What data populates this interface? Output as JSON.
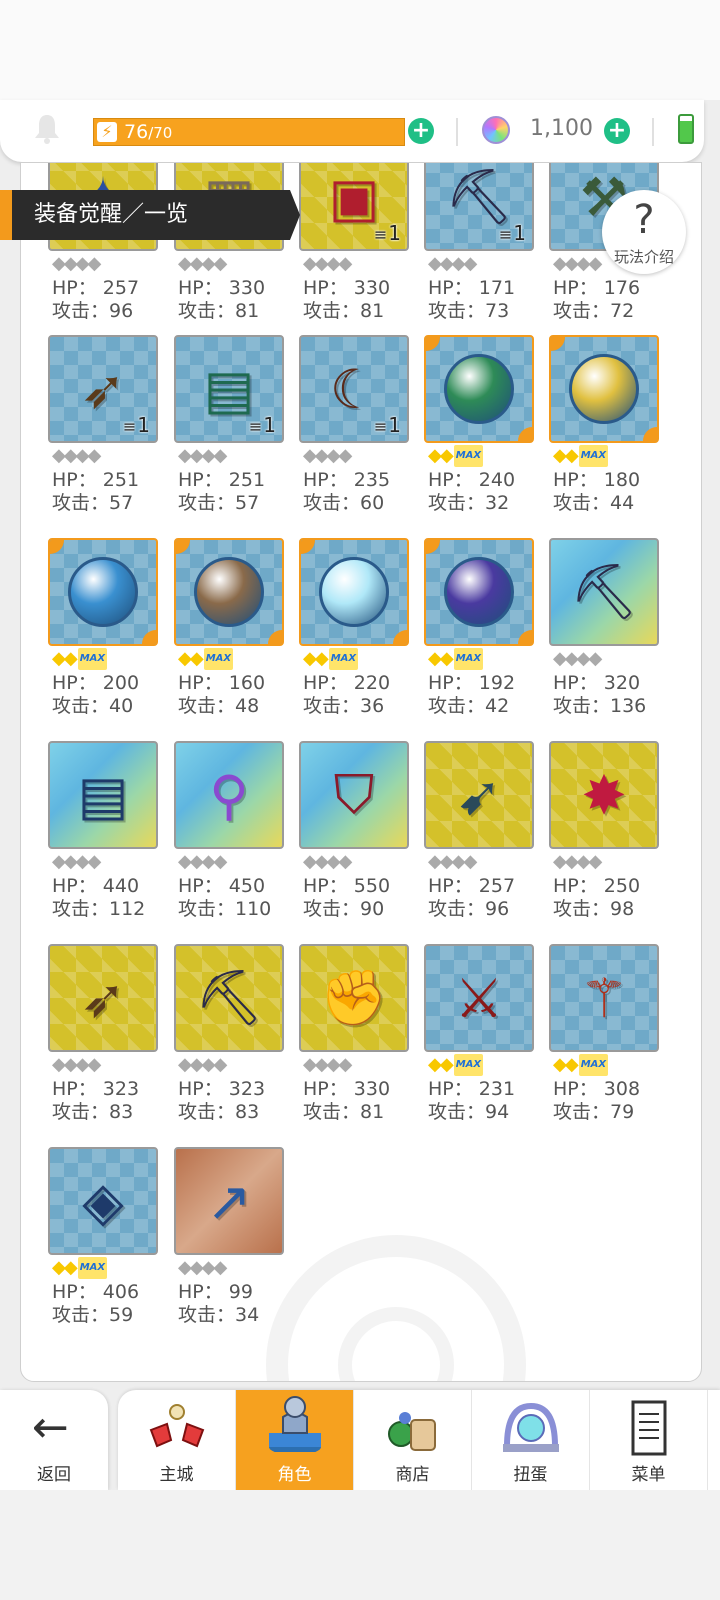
{
  "status": {
    "energy_current": "76",
    "energy_max": "/70",
    "gems": "1,100"
  },
  "header": {
    "title": "装备觉醒／一览",
    "help_label": "玩法介绍"
  },
  "items": [
    {
      "hp": "HP： 257",
      "atk": "攻击：96",
      "frame": "gold",
      "stars": "gray",
      "icon": "amulet-icon",
      "count": ""
    },
    {
      "hp": "HP： 330",
      "atk": "攻击：81",
      "frame": "gold",
      "stars": "gray",
      "icon": "scroll-icon",
      "count": ""
    },
    {
      "hp": "HP： 330",
      "atk": "攻击：81",
      "frame": "gold",
      "stars": "gray",
      "icon": "chest-icon",
      "count": "1"
    },
    {
      "hp": "HP： 171",
      "atk": "攻击：73",
      "frame": "blue",
      "stars": "gray",
      "icon": "pickaxe-icon",
      "count": "1"
    },
    {
      "hp": "HP： 176",
      "atk": "攻击：72",
      "frame": "blue",
      "stars": "gray",
      "icon": "axe-icon",
      "count": ""
    },
    {
      "hp": "HP： 251",
      "atk": "攻击：57",
      "frame": "blue",
      "stars": "gray",
      "icon": "bow-icon",
      "count": "1"
    },
    {
      "hp": "HP： 251",
      "atk": "攻击：57",
      "frame": "blue",
      "stars": "gray",
      "icon": "book-icon",
      "count": "1"
    },
    {
      "hp": "HP： 235",
      "atk": "攻击：60",
      "frame": "blue",
      "stars": "gray",
      "icon": "boomerang-icon",
      "count": "1"
    },
    {
      "hp": "HP： 240",
      "atk": "攻击：32",
      "frame": "orb",
      "stars": "max",
      "icon": "globe-forest-icon",
      "count": ""
    },
    {
      "hp": "HP： 180",
      "atk": "攻击：44",
      "frame": "orb",
      "stars": "max",
      "icon": "globe-desert-icon",
      "count": ""
    },
    {
      "hp": "HP： 200",
      "atk": "攻击：40",
      "frame": "orb",
      "stars": "max",
      "icon": "globe-ship-icon",
      "count": ""
    },
    {
      "hp": "HP： 160",
      "atk": "攻击：48",
      "frame": "orb",
      "stars": "max",
      "icon": "globe-ruins-icon",
      "count": ""
    },
    {
      "hp": "HP： 220",
      "atk": "攻击：36",
      "frame": "orb",
      "stars": "max",
      "icon": "globe-ice-icon",
      "count": ""
    },
    {
      "hp": "HP： 192",
      "atk": "攻击：42",
      "frame": "orb",
      "stars": "max",
      "icon": "globe-night-icon",
      "count": ""
    },
    {
      "hp": "HP： 320",
      "atk": "攻击：136",
      "frame": "rainbow",
      "stars": "gray",
      "icon": "pickaxe-icon",
      "count": ""
    },
    {
      "hp": "HP： 440",
      "atk": "攻击：112",
      "frame": "rainbow",
      "stars": "gray",
      "icon": "spellbook-icon",
      "count": ""
    },
    {
      "hp": "HP： 450",
      "atk": "攻击：110",
      "frame": "rainbow",
      "stars": "gray",
      "icon": "magic-wand-icon",
      "count": ""
    },
    {
      "hp": "HP： 550",
      "atk": "攻击：90",
      "frame": "rainbow",
      "stars": "gray",
      "icon": "shield-icon",
      "count": ""
    },
    {
      "hp": "HP： 257",
      "atk": "攻击：96",
      "frame": "gold",
      "stars": "gray",
      "icon": "spear-icon",
      "count": ""
    },
    {
      "hp": "HP： 250",
      "atk": "攻击：98",
      "frame": "gold",
      "stars": "gray",
      "icon": "star-staff-icon",
      "count": ""
    },
    {
      "hp": "HP： 323",
      "atk": "攻击：83",
      "frame": "gold",
      "stars": "gray",
      "icon": "bow-icon",
      "count": ""
    },
    {
      "hp": "HP： 323",
      "atk": "攻击：83",
      "frame": "gold",
      "stars": "gray",
      "icon": "pickaxe-icon",
      "count": ""
    },
    {
      "hp": "HP： 330",
      "atk": "攻击：81",
      "frame": "gold",
      "stars": "gray",
      "icon": "gauntlet-icon",
      "count": ""
    },
    {
      "hp": "HP： 231",
      "atk": "攻击：94",
      "frame": "blue",
      "stars": "max",
      "icon": "battle-axe-icon",
      "count": ""
    },
    {
      "hp": "HP： 308",
      "atk": "攻击：79",
      "frame": "blue",
      "stars": "max",
      "icon": "scepter-icon",
      "count": ""
    },
    {
      "hp": "HP： 406",
      "atk": "攻击：59",
      "frame": "blue",
      "stars": "max",
      "icon": "mirror-icon",
      "count": ""
    },
    {
      "hp": "HP： 99",
      "atk": "攻击：34",
      "frame": "bronze",
      "stars": "gray",
      "icon": "harpoon-icon",
      "count": ""
    }
  ],
  "stars_max_label": "MAX",
  "nav": {
    "back": "返回",
    "tabs": [
      {
        "label": "主城",
        "icon": "castle-icon"
      },
      {
        "label": "角色",
        "icon": "character-icon",
        "active": true
      },
      {
        "label": "商店",
        "icon": "shop-icon"
      },
      {
        "label": "扭蛋",
        "icon": "gacha-icon"
      },
      {
        "label": "菜单",
        "icon": "menu-icon"
      }
    ]
  },
  "colors": {
    "accent_orange": "#f6a11f",
    "plus_green": "#1fbf86",
    "banner_dark": "#2b2b2b",
    "star_gold": "#f8c800"
  }
}
